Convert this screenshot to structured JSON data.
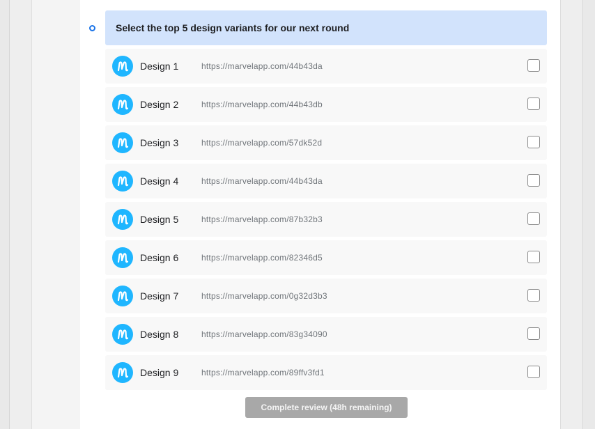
{
  "question": {
    "text": "Select the top 5 design variants for our next round"
  },
  "designs": [
    {
      "name": "Design 1",
      "url": "https://marvelapp.com/44b43da",
      "checked": false
    },
    {
      "name": "Design 2",
      "url": "https://marvelapp.com/44b43db",
      "checked": false
    },
    {
      "name": "Design 3",
      "url": "https://marvelapp.com/57dk52d",
      "checked": false
    },
    {
      "name": "Design 4",
      "url": "https://marvelapp.com/44b43da",
      "checked": false
    },
    {
      "name": "Design 5",
      "url": "https://marvelapp.com/87b32b3",
      "checked": false
    },
    {
      "name": "Design 6",
      "url": "https://marvelapp.com/82346d5",
      "checked": false
    },
    {
      "name": "Design 7",
      "url": "https://marvelapp.com/0g32d3b3",
      "checked": false
    },
    {
      "name": "Design 8",
      "url": "https://marvelapp.com/83g34090",
      "checked": false
    },
    {
      "name": "Design 9",
      "url": "https://marvelapp.com/89ffv3fd1",
      "checked": false
    }
  ],
  "logo_icon": "marvel-logo-icon",
  "submit": {
    "label": "Complete review (48h remaining)",
    "disabled": true
  },
  "colors": {
    "accent": "#1a73e8",
    "header_bg": "#d2e3fc",
    "logo": "#1fb6ff",
    "button_disabled": "#a8a8a8"
  }
}
